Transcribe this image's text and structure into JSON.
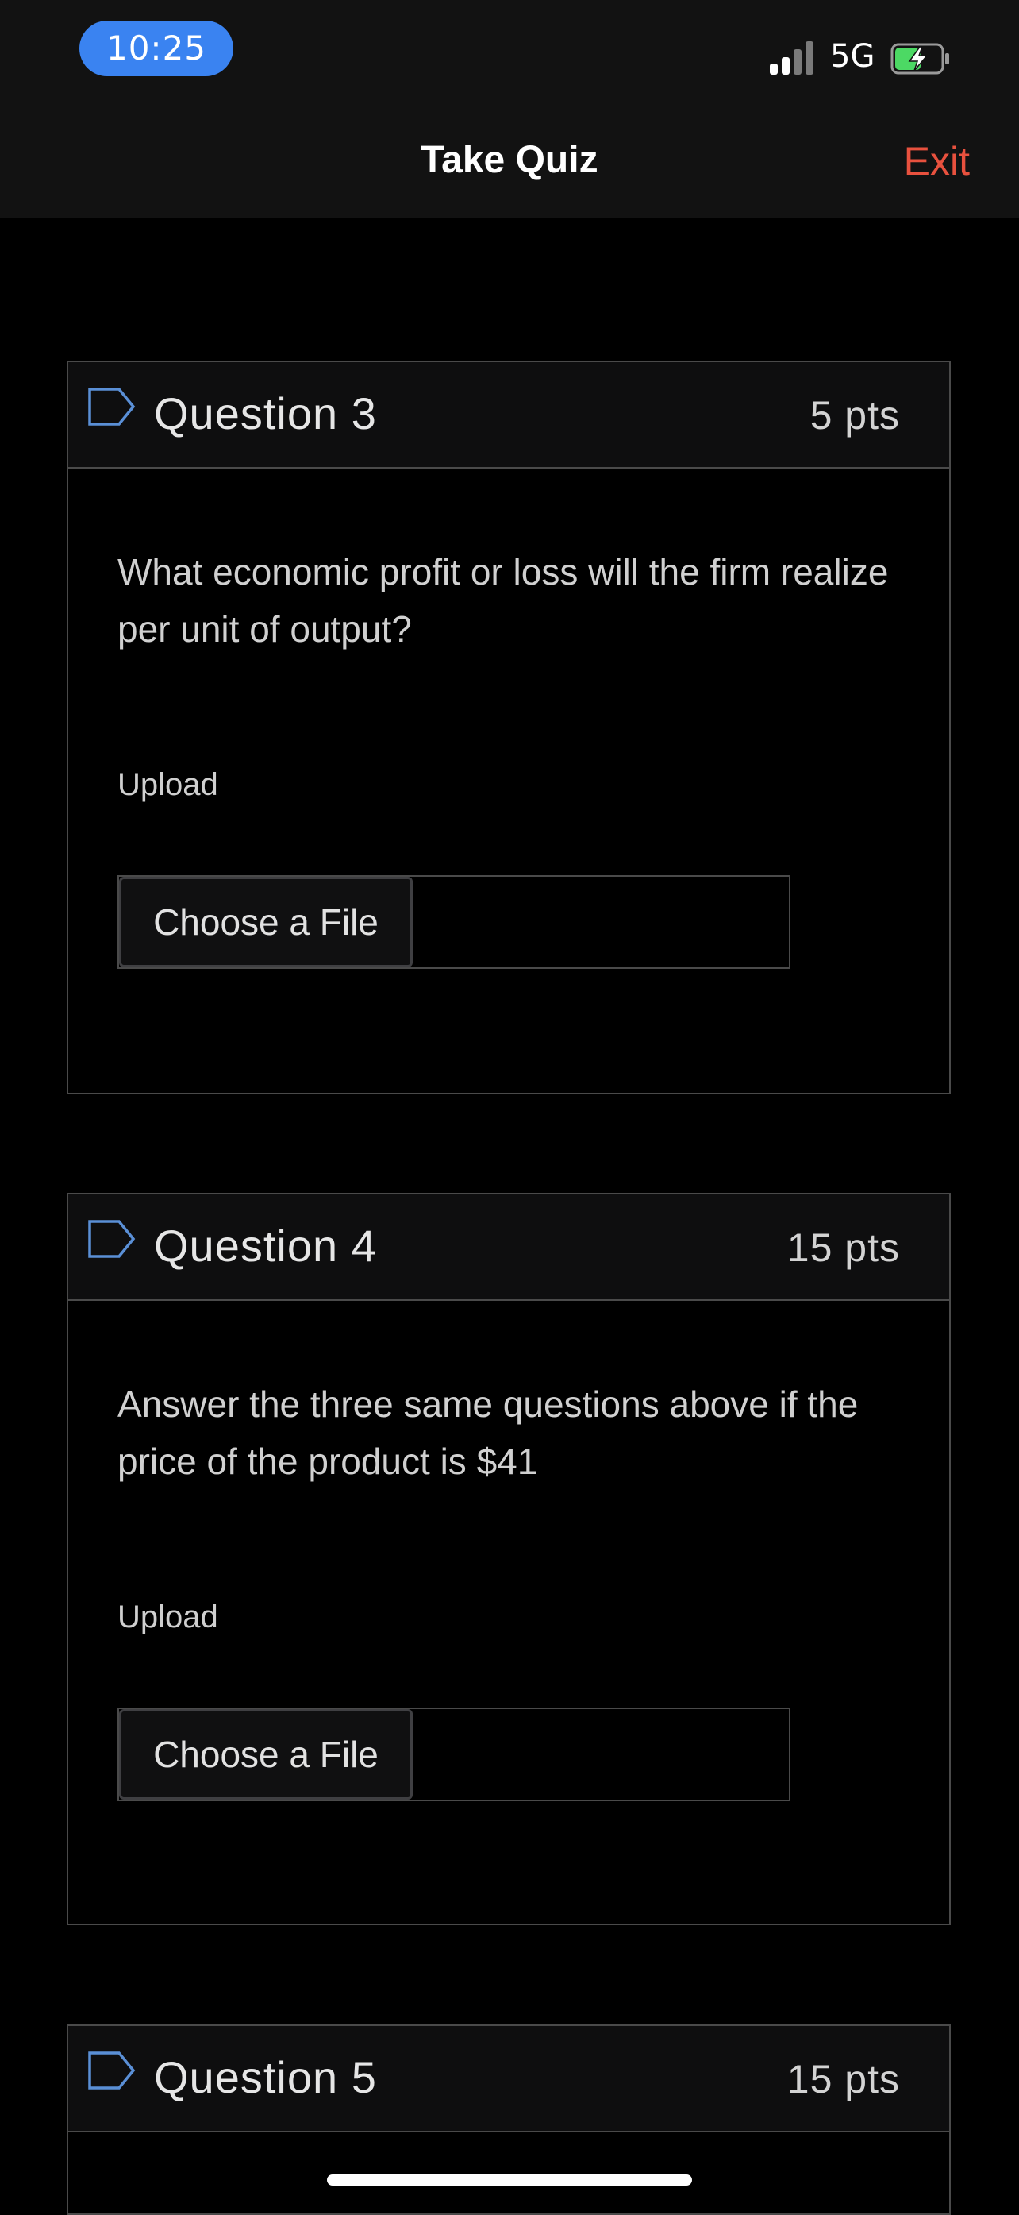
{
  "status_bar": {
    "time": "10:25",
    "network": "5G",
    "colors": {
      "time_pill": "#3a83f1",
      "battery_fill": "#4cd964"
    }
  },
  "nav": {
    "title": "Take Quiz",
    "exit_label": "Exit",
    "exit_color": "#e8513e"
  },
  "questions": [
    {
      "title": "Question 3",
      "points": "5 pts",
      "text": "What economic profit or loss will the firm realize per unit of output?",
      "upload_label": "Upload",
      "file_button": "Choose a File"
    },
    {
      "title": "Question 4",
      "points": "15 pts",
      "text": "Answer the three same questions above if the price of the product is $41",
      "upload_label": "Upload",
      "file_button": "Choose a File"
    },
    {
      "title": "Question 5",
      "points": "15 pts"
    }
  ],
  "icons": {
    "flag": "flag-question-icon",
    "signal": "cellular-signal-icon",
    "battery": "battery-charging-icon"
  }
}
